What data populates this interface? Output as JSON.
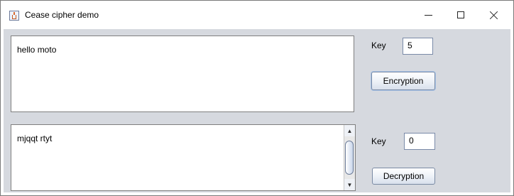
{
  "window": {
    "title": "Cease cipher demo",
    "controls": {
      "minimize": "minimize-icon",
      "maximize": "maximize-icon",
      "close": "close-icon"
    }
  },
  "plaintext": {
    "value": "hello moto"
  },
  "ciphertext": {
    "value": "mjqqt rtyt"
  },
  "encrypt_panel": {
    "key_label": "Key",
    "key_value": "5",
    "button_label": "Encryption"
  },
  "decrypt_panel": {
    "key_label": "Key",
    "key_value": "0",
    "button_label": "Decryption"
  },
  "colors": {
    "panel_bg": "#d6d9df",
    "titlebar_bg": "#ffffff"
  }
}
